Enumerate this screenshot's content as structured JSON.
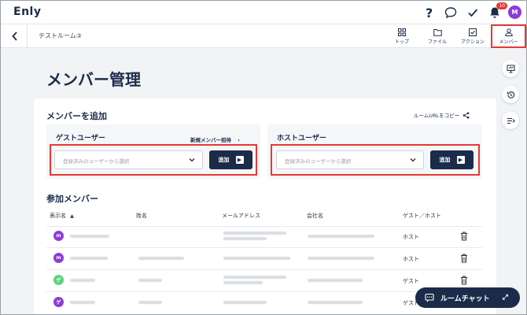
{
  "app": {
    "logo": "Enly",
    "notification_count": "10",
    "user_initial": "M"
  },
  "header": {
    "room_name": "テストルーム③"
  },
  "nav_tabs": [
    {
      "label": "トップ",
      "icon": "grid-icon"
    },
    {
      "label": "ファイル",
      "icon": "folder-icon"
    },
    {
      "label": "アクション",
      "icon": "checkbox-icon"
    },
    {
      "label": "メンバー",
      "icon": "person-icon",
      "active": true
    }
  ],
  "page": {
    "title": "メンバー管理"
  },
  "add_member": {
    "title": "メンバーを追加",
    "copy_room_url": "ルームURLをコピー",
    "guest": {
      "title": "ゲストユーザー",
      "invite_link": "新規メンバー招待",
      "placeholder": "登録済みのユーザーから選択",
      "add_label": "追加"
    },
    "host": {
      "title": "ホストユーザー",
      "placeholder": "登録済みのユーザーから選択",
      "add_label": "追加"
    }
  },
  "participants": {
    "title": "参加メンバー",
    "columns": {
      "display_name": "表示名",
      "name": "姓名",
      "email": "メールアドレス",
      "company": "会社名",
      "role": "ゲスト／ホスト"
    },
    "rows": [
      {
        "initial": "m",
        "color": "#8e3bd8",
        "role": "ホスト"
      },
      {
        "initial": "m",
        "color": "#8e3bd8",
        "role": "ホスト"
      },
      {
        "initial": "ゲ",
        "color": "#5dd37a",
        "role": "ゲスト"
      },
      {
        "initial": "ゲ",
        "color": "#8e3bd8",
        "role": "ゲスト"
      }
    ]
  },
  "chat": {
    "label": "ルームチャット"
  }
}
